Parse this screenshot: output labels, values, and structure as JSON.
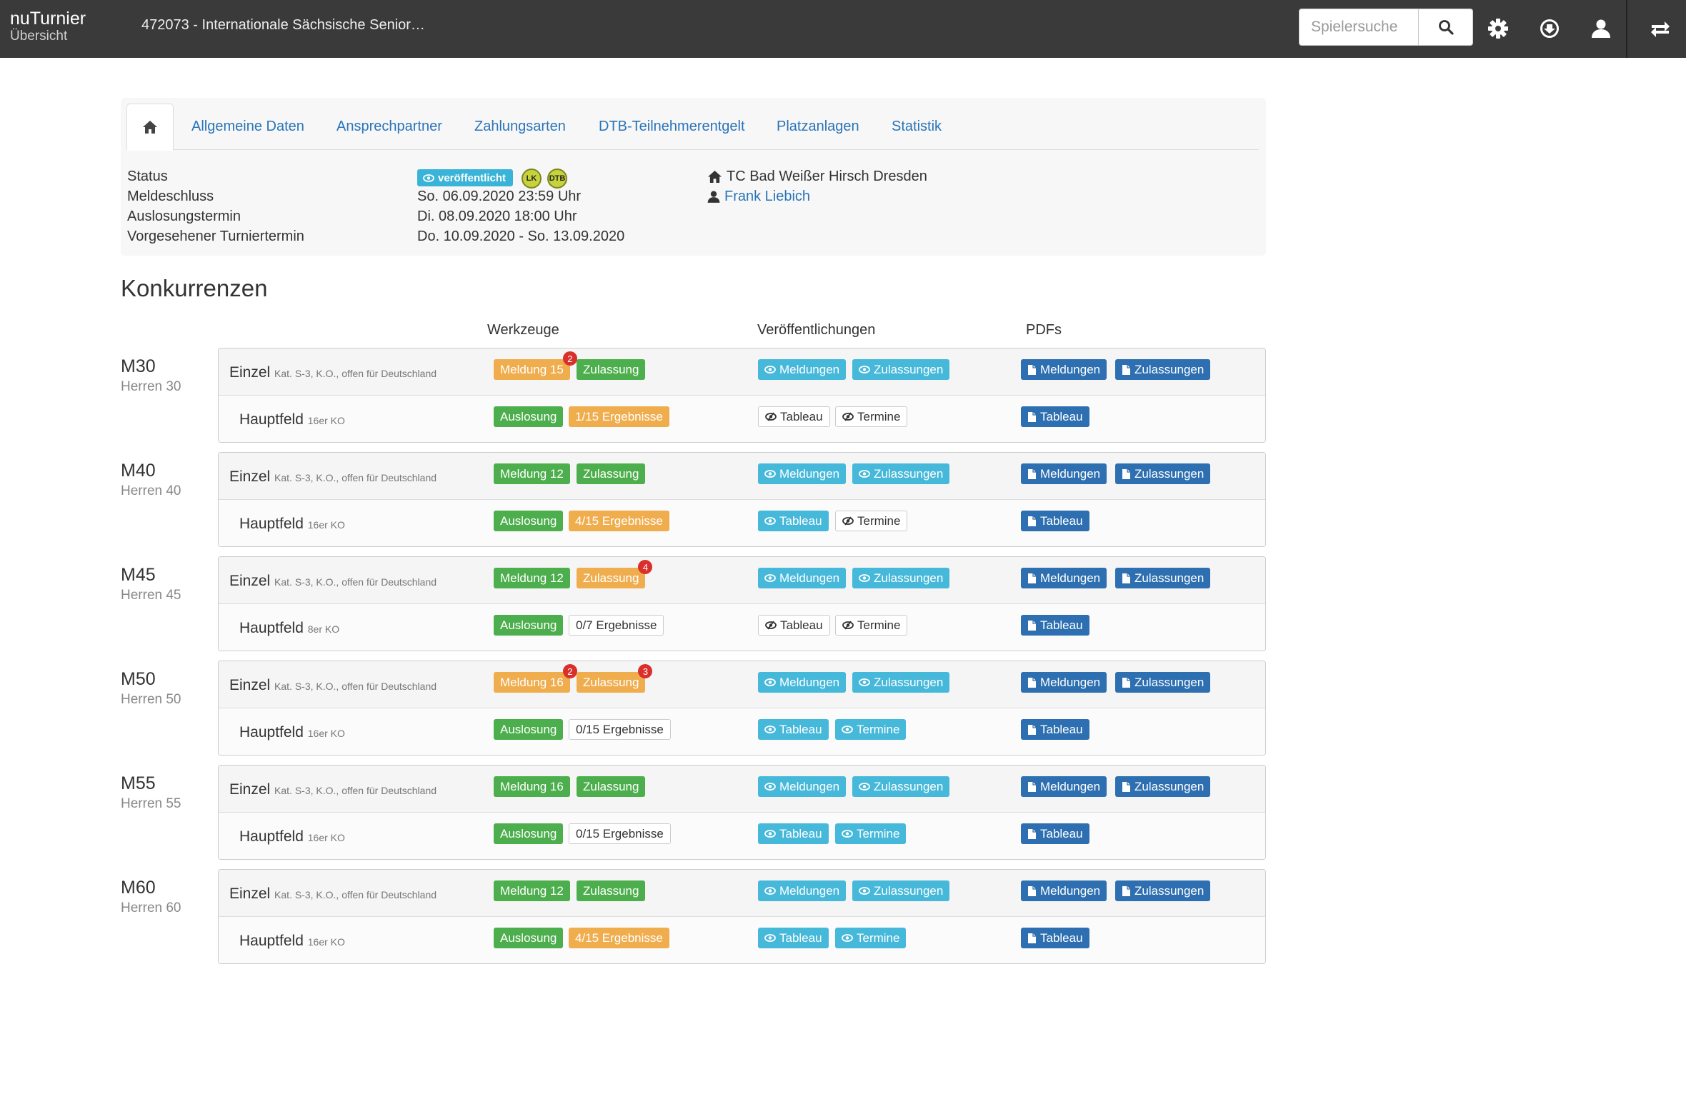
{
  "app": {
    "name": "nuTurnier",
    "subtitle": "Übersicht",
    "tournament_title": "472073 - Internationale Sächsische Senior…"
  },
  "search": {
    "placeholder": "Spielersuche"
  },
  "nav_icons": [
    "search-icon",
    "gear-icon",
    "download-icon",
    "user-icon",
    "swap-icon"
  ],
  "tabs": [
    "Allgemeine Daten",
    "Ansprechpartner",
    "Zahlungsarten",
    "DTB-Teilnehmerentgelt",
    "Platzanlagen",
    "Statistik"
  ],
  "info": {
    "labels": [
      "Status",
      "Meldeschluss",
      "Auslosungstermin",
      "Vorgesehener Turniertermin"
    ],
    "status_badge": "veröffentlicht",
    "badge_lk": "LK",
    "badge_dtb": "DTB",
    "meldeschluss": "So. 06.09.2020 23:59 Uhr",
    "auslosungstermin": "Di. 08.09.2020 18:00 Uhr",
    "turniertermin": "Do. 10.09.2020 - So. 13.09.2020",
    "club": "TC Bad Weißer Hirsch Dresden",
    "contact": "Frank Liebich"
  },
  "section_title": "Konkurrenzen",
  "columns": [
    "Werkzeuge",
    "Veröffentlichungen",
    "PDFs"
  ],
  "common": {
    "einzel": "Einzel",
    "einzel_desc": "Kat. S-3, K.O., offen für Deutschland",
    "hauptfeld": "Hauptfeld",
    "zulassung": "Zulassung",
    "auslosung": "Auslosung",
    "meldungen": "Meldungen",
    "zulassungen": "Zulassungen",
    "tableau": "Tableau",
    "termine": "Termine"
  },
  "competitions": [
    {
      "code": "M30",
      "name": "Herren 30",
      "meldung": "Meldung 15",
      "meldung_notif": "2",
      "zulassung_notif": "",
      "draw_size": "16er KO",
      "ergebnisse": "1/15 Ergebnisse"
    },
    {
      "code": "M40",
      "name": "Herren 40",
      "meldung": "Meldung 12",
      "meldung_notif": "",
      "zulassung_notif": "",
      "draw_size": "16er KO",
      "ergebnisse": "4/15 Ergebnisse"
    },
    {
      "code": "M45",
      "name": "Herren 45",
      "meldung": "Meldung 12",
      "meldung_notif": "",
      "zulassung_notif": "4",
      "draw_size": "8er KO",
      "ergebnisse": "0/7 Ergebnisse"
    },
    {
      "code": "M50",
      "name": "Herren 50",
      "meldung": "Meldung 16",
      "meldung_notif": "2",
      "zulassung_notif": "3",
      "draw_size": "16er KO",
      "ergebnisse": "0/15 Ergebnisse"
    },
    {
      "code": "M55",
      "name": "Herren 55",
      "meldung": "Meldung 16",
      "meldung_notif": "",
      "zulassung_notif": "",
      "draw_size": "16er KO",
      "ergebnisse": "0/15 Ergebnisse"
    },
    {
      "code": "M60",
      "name": "Herren 60",
      "meldung": "Meldung 12",
      "meldung_notif": "",
      "zulassung_notif": "",
      "draw_size": "16er KO",
      "ergebnisse": "4/15 Ergebnisse"
    }
  ],
  "colors": {
    "navbar": "#3a3a3a",
    "green": "#4cae4c",
    "orange": "#f0ad4e",
    "cyan": "#46b8da",
    "blue": "#2d6fb0",
    "link": "#2a74b8",
    "notif": "#d9302c"
  }
}
